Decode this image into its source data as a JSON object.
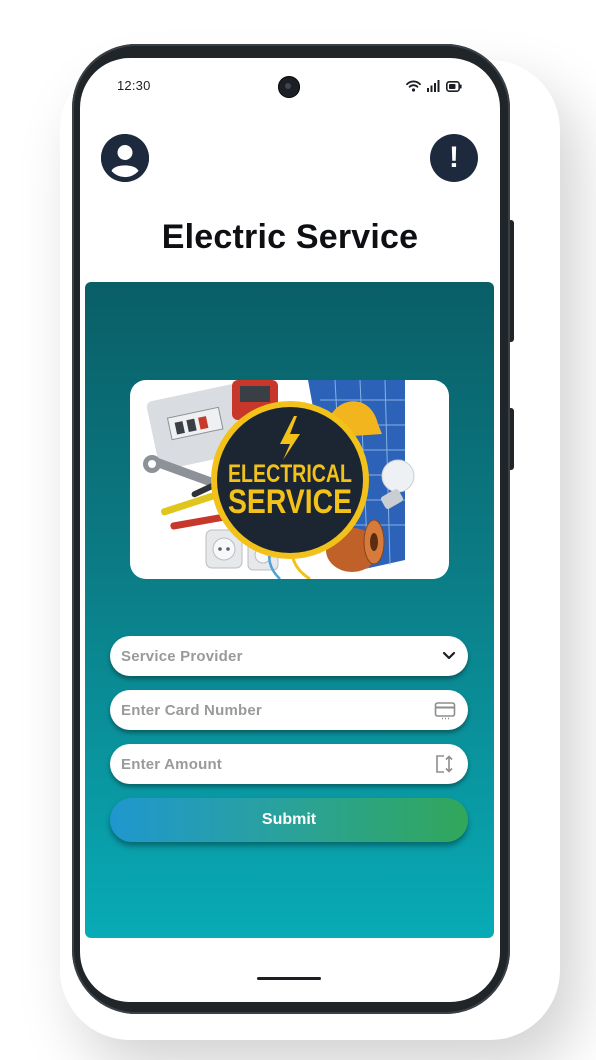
{
  "status_bar": {
    "time": "12:30"
  },
  "header": {
    "profile_icon": "user-circle-icon",
    "alert_icon": "exclamation-icon",
    "alert_glyph": "!",
    "title": "Electric Service"
  },
  "banner": {
    "line1": "ELECTRICAL",
    "line2": "SERVICE"
  },
  "form": {
    "provider": {
      "placeholder": "Service Provider",
      "icon": "chevron-down-icon"
    },
    "card_number": {
      "placeholder": "Enter Card Number",
      "icon": "credit-card-icon"
    },
    "amount": {
      "placeholder": "Enter Amount",
      "icon": "amount-transfer-icon"
    },
    "submit_label": "Submit"
  },
  "colors": {
    "panel_top": "#0a5e67",
    "panel_bottom": "#08abb6",
    "button_start": "#1f97cf",
    "button_end": "#31a75a",
    "icon_bg": "#1d2a3e",
    "badge_yellow": "#f2c21b"
  }
}
